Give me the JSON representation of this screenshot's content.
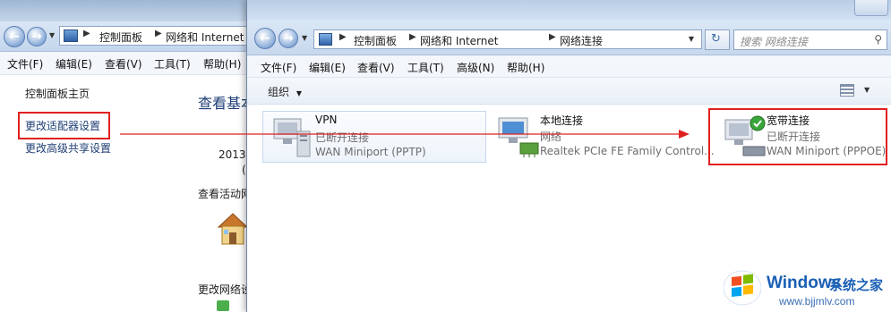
{
  "background_window": {
    "breadcrumbs": [
      "控制面板",
      "网络和 Internet"
    ],
    "menu": [
      "文件(F)",
      "编辑(E)",
      "查看(V)",
      "工具(T)",
      "帮助(H)"
    ],
    "sidebar_links": [
      "控制面板主页",
      "更改适配器设置",
      "更改高级共享设置"
    ],
    "main_heading": "查看基本",
    "main_year": "2013",
    "main_paren": "(",
    "main_active": "查看活动网",
    "main_change": "更改网络设"
  },
  "front_window": {
    "breadcrumbs": [
      "控制面板",
      "网络和 Internet",
      "网络连接"
    ],
    "search_placeholder": "搜索 网络连接",
    "menu": [
      "文件(F)",
      "编辑(E)",
      "查看(V)",
      "工具(T)",
      "高级(N)",
      "帮助(H)"
    ],
    "toolbar_organize": "组织",
    "adapters": [
      {
        "name": "VPN",
        "status": "已断开连接",
        "device": "WAN Miniport (PPTP)"
      },
      {
        "name": "本地连接",
        "status": "网络",
        "device": "Realtek PCIe FE Family Control..."
      },
      {
        "name": "宽带连接",
        "status": "已断开连接",
        "device": "WAN Miniport (PPPOE)"
      }
    ]
  },
  "watermark": {
    "brand": "Windows",
    "sub": "系统之家",
    "url": "www.bjjmlv.com"
  },
  "colors": {
    "highlight": "#e02020",
    "link": "#1e3e76",
    "brand_blue": "#1a5fb4"
  }
}
